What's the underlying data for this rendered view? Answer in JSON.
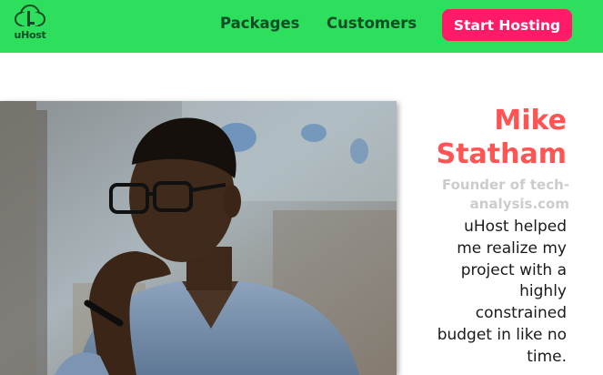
{
  "header": {
    "logo_text": "uHost",
    "nav": {
      "packages": "Packages",
      "customers": "Customers"
    },
    "cta_label": "Start Hosting"
  },
  "testimonial": {
    "name_line1": "Mike",
    "name_line2": "Statham",
    "role_line1": "Founder of tech-",
    "role_line2": "analysis.com",
    "quote_lines": [
      "uHost helped",
      "me realize my",
      "project with a",
      "highly",
      "constrained",
      "budget in like no",
      "time."
    ]
  },
  "colors": {
    "header_bg": "#2ddf5c",
    "nav_text": "#0e4d26",
    "cta_bg": "#ff1b68",
    "name": "#ff5454",
    "role": "#cccccc"
  }
}
